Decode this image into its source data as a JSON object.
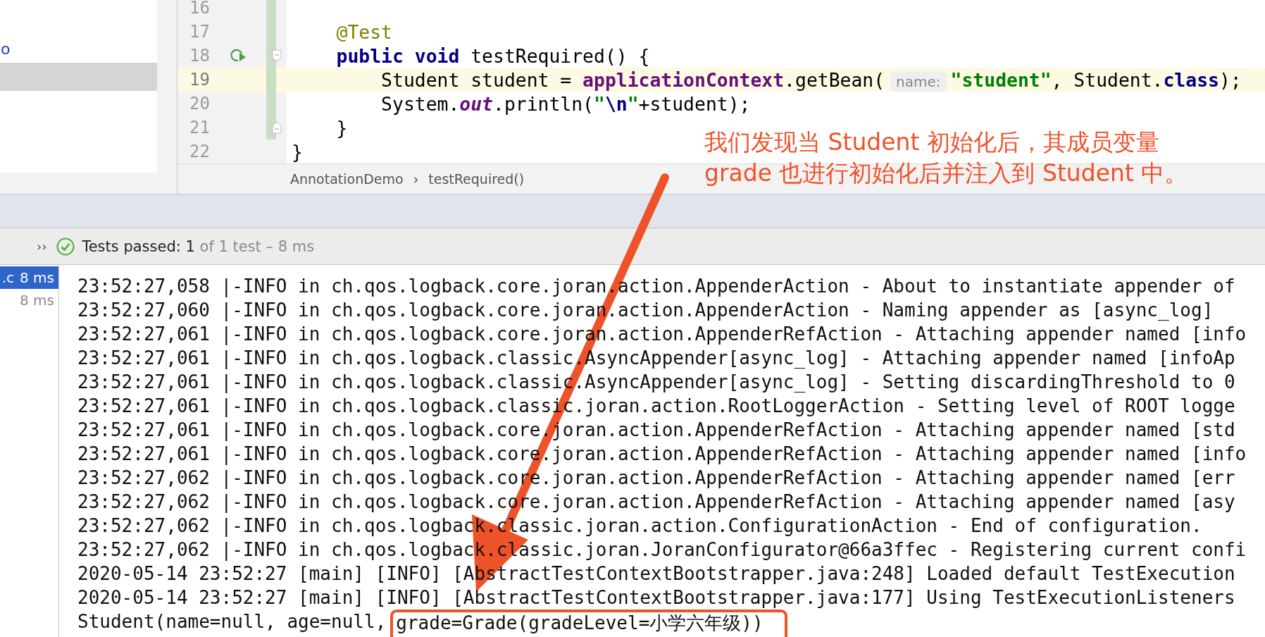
{
  "project_panel": {
    "items": [
      {
        "label": "o",
        "selected": false
      },
      {
        "selected": true
      }
    ]
  },
  "editor": {
    "lines": [
      {
        "number": "16",
        "current": false,
        "changed": true,
        "run_button": false,
        "fold_start": false,
        "fold_end": false
      },
      {
        "number": "17",
        "current": false,
        "changed": true,
        "run_button": false,
        "fold_start": false,
        "fold_end": false,
        "tokens": [
          {
            "kind": "annotation",
            "text": "    @Test"
          }
        ]
      },
      {
        "number": "18",
        "current": false,
        "changed": true,
        "run_button": true,
        "fold_start": true,
        "fold_end": false,
        "tokens": [
          {
            "kind": "keyword",
            "text": "    public"
          },
          {
            "kind": "keyword",
            "text": " void"
          },
          {
            "kind": "plain",
            "text": " testRequired() {"
          }
        ]
      },
      {
        "number": "19",
        "current": true,
        "changed": true,
        "run_button": false,
        "fold_start": false,
        "fold_end": false,
        "tokens": [
          {
            "kind": "plain",
            "text": "        Student student = "
          },
          {
            "kind": "field",
            "text": "applicationContext"
          },
          {
            "kind": "plain",
            "text": ".getBean("
          },
          {
            "kind": "hint",
            "text": "name:"
          },
          {
            "kind": "string",
            "text": "\"student\""
          },
          {
            "kind": "plain",
            "text": ", Student."
          },
          {
            "kind": "keyword",
            "text": "class"
          },
          {
            "kind": "plain",
            "text": ");"
          }
        ]
      },
      {
        "number": "20",
        "current": false,
        "changed": true,
        "run_button": false,
        "fold_start": false,
        "fold_end": false,
        "tokens": [
          {
            "kind": "plain",
            "text": "        System."
          },
          {
            "kind": "static",
            "text": "out"
          },
          {
            "kind": "plain",
            "text": ".println("
          },
          {
            "kind": "string",
            "text": "\""
          },
          {
            "kind": "escape",
            "text": "\\n"
          },
          {
            "kind": "string",
            "text": "\""
          },
          {
            "kind": "plain",
            "text": "+student);"
          }
        ]
      },
      {
        "number": "21",
        "current": false,
        "changed": true,
        "run_button": false,
        "fold_start": false,
        "fold_end": true,
        "tokens": [
          {
            "kind": "plain",
            "text": "    }"
          }
        ]
      },
      {
        "number": "22",
        "current": false,
        "changed": false,
        "run_button": false,
        "fold_start": false,
        "fold_end": false,
        "tokens": [
          {
            "kind": "plain",
            "text": "}"
          }
        ]
      }
    ]
  },
  "breadcrumbs": {
    "items": [
      "AnnotationDemo",
      "testRequired()"
    ],
    "separator": "›"
  },
  "test_status": {
    "expand": "››",
    "passed": true,
    "label": "Tests passed:",
    "count": "1",
    "detail": "of 1 test – 8 ms"
  },
  "test_tree": [
    {
      "label": ".c",
      "duration": "8 ms",
      "selected": true
    },
    {
      "duration": "8 ms",
      "selected": false
    }
  ],
  "console": {
    "lines": [
      "23:52:27,058 |-INFO in ch.qos.logback.core.joran.action.AppenderAction - About to instantiate appender of",
      "23:52:27,060 |-INFO in ch.qos.logback.core.joran.action.AppenderAction - Naming appender as [async_log]",
      "23:52:27,061 |-INFO in ch.qos.logback.core.joran.action.AppenderRefAction - Attaching appender named [info",
      "23:52:27,061 |-INFO in ch.qos.logback.classic.AsyncAppender[async_log] - Attaching appender named [infoAp",
      "23:52:27,061 |-INFO in ch.qos.logback.classic.AsyncAppender[async_log] - Setting discardingThreshold to 0",
      "23:52:27,061 |-INFO in ch.qos.logback.classic.joran.action.RootLoggerAction - Setting level of ROOT logge",
      "23:52:27,061 |-INFO in ch.qos.logback.core.joran.action.AppenderRefAction - Attaching appender named [std",
      "23:52:27,061 |-INFO in ch.qos.logback.core.joran.action.AppenderRefAction - Attaching appender named [info",
      "23:52:27,062 |-INFO in ch.qos.logback.core.joran.action.AppenderRefAction - Attaching appender named [err",
      "23:52:27,062 |-INFO in ch.qos.logback.core.joran.action.AppenderRefAction - Attaching appender named [asy",
      "23:52:27,062 |-INFO in ch.qos.logback.classic.joran.action.ConfigurationAction - End of configuration.",
      "23:52:27,062 |-INFO in ch.qos.logback.classic.joran.JoranConfigurator@66a3ffec - Registering current confi",
      "2020-05-14 23:52:27 [main] [INFO] [AbstractTestContextBootstrapper.java:248] Loaded default TestExecution",
      "2020-05-14 23:52:27 [main] [INFO] [AbstractTestContextBootstrapper.java:177] Using TestExecutionListeners"
    ],
    "last_line": [
      {
        "text": "Student(name=null, age=null,",
        "highlighted": false
      },
      {
        "text": "grade=Grade(gradeLevel=小学六年级))",
        "highlighted": true
      }
    ]
  },
  "annotation": {
    "lines": [
      "我们发现当 Student 初始化后，其成员变量",
      "grade 也进行初始化后并注入到 Student 中。"
    ]
  }
}
